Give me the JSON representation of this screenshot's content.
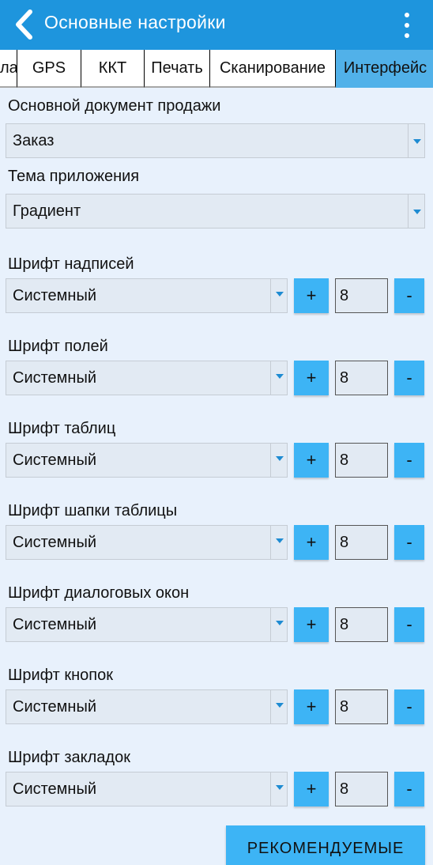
{
  "header": {
    "title": "Основные настройки",
    "back_icon": "chevron-left-icon",
    "menu_icon": "more-vertical-icon"
  },
  "tabs": [
    {
      "label": "ла",
      "active": false
    },
    {
      "label": "GPS",
      "active": false
    },
    {
      "label": "ККТ",
      "active": false
    },
    {
      "label": "Печать",
      "active": false
    },
    {
      "label": "Сканирование",
      "active": false
    },
    {
      "label": "Интерфейс",
      "active": true
    }
  ],
  "settings": {
    "sale_doc": {
      "label": "Основной документ продажи",
      "value": "Заказ"
    },
    "theme": {
      "label": "Тема приложения",
      "value": "Градиент"
    }
  },
  "fonts": [
    {
      "label": "Шрифт надписей",
      "value": "Системный",
      "size": "8"
    },
    {
      "label": "Шрифт полей",
      "value": "Системный",
      "size": "8"
    },
    {
      "label": "Шрифт таблиц",
      "value": "Системный",
      "size": "8"
    },
    {
      "label": "Шрифт шапки таблицы",
      "value": "Системный",
      "size": "8"
    },
    {
      "label": "Шрифт диалоговых окон",
      "value": "Системный",
      "size": "8"
    },
    {
      "label": "Шрифт кнопок",
      "value": "Системный",
      "size": "8"
    },
    {
      "label": "Шрифт закладок",
      "value": "Системный",
      "size": "8"
    }
  ],
  "controls": {
    "plus": "+",
    "minus": "-"
  },
  "recommended_button": "РЕКОМЕНДУЕМЫЕ",
  "colors": {
    "app_bar": "#1e95dd",
    "active_tab": "#51b1e9",
    "button": "#3db4f5",
    "background": "#e8f1fc"
  }
}
